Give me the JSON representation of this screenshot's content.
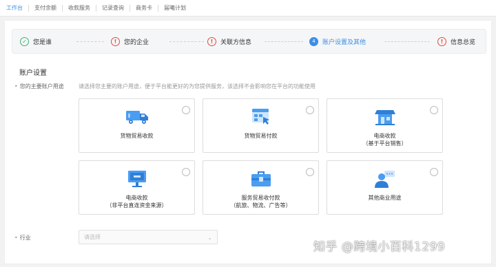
{
  "nav": {
    "items": [
      {
        "label": "工作台",
        "active": true
      },
      {
        "label": "支付余额"
      },
      {
        "label": "收款服务"
      },
      {
        "label": "记录查询"
      },
      {
        "label": "商务卡"
      },
      {
        "label": "届曦计划"
      }
    ]
  },
  "steps": [
    {
      "label": "您是谁",
      "state": "done"
    },
    {
      "label": "您的企业",
      "state": "error"
    },
    {
      "label": "关联方信息",
      "state": "error"
    },
    {
      "label": "账户设置及其他",
      "state": "current",
      "number": "4"
    },
    {
      "label": "信息总览",
      "state": "error"
    }
  ],
  "section": {
    "title": "账户设置"
  },
  "usage": {
    "label": "您的主要账户用途",
    "hint": "请选择您主要的账户用途，便于平台能更好的为您提供服务，该选择不会影响您在平台的功能使用",
    "options": [
      {
        "line1": "货物贸易收款",
        "line2": "",
        "icon": "delivery-truck-icon"
      },
      {
        "line1": "货物贸易付款",
        "line2": "",
        "icon": "payment-click-icon"
      },
      {
        "line1": "电商收款",
        "line2": "（基于平台销售）",
        "icon": "storefront-icon"
      },
      {
        "line1": "电商收款",
        "line2": "（非平台直连资金来源）",
        "icon": "monitor-icon"
      },
      {
        "line1": "服务贸易收付款",
        "line2": "（航旅、物流、广告等）",
        "icon": "toolbox-icon"
      },
      {
        "line1": "其他商业用途",
        "line2": "",
        "icon": "chat-person-icon"
      }
    ]
  },
  "industry": {
    "label": "行业",
    "placeholder": "请选择"
  },
  "watermark": "知乎 @跨境小百科1299",
  "colors": {
    "accent": "#3a8ee6",
    "success": "#3cb371",
    "error": "#e04a3a",
    "icon_blue": "#4a9df0"
  }
}
